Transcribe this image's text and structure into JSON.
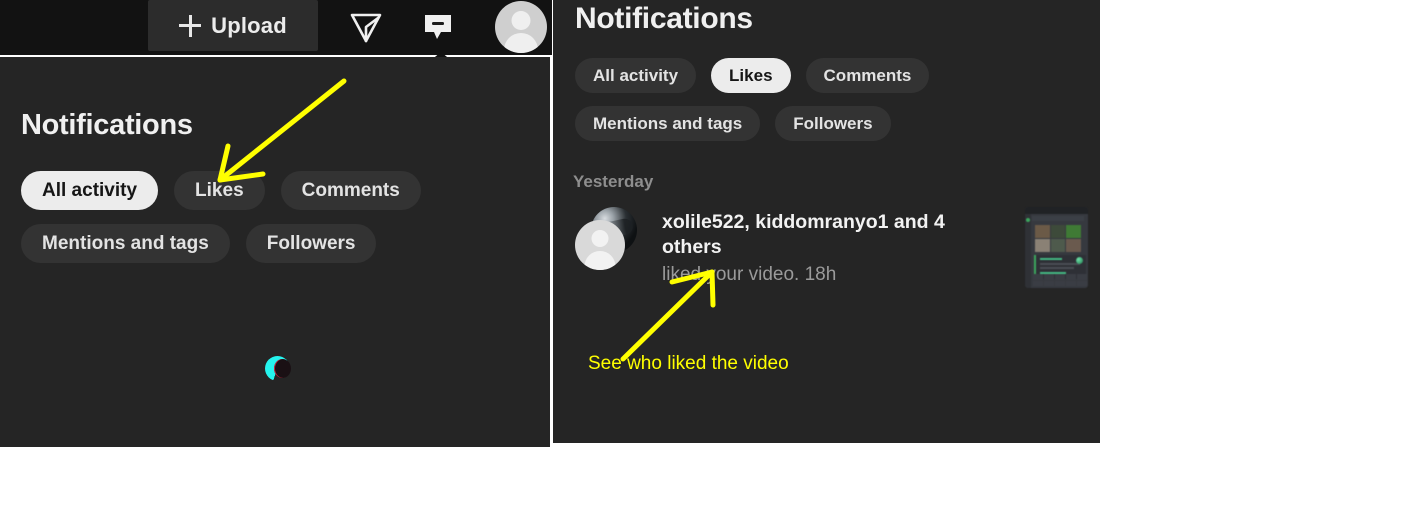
{
  "navbar": {
    "upload_button": {
      "label": "Upload",
      "icon": "plus-icon"
    },
    "send_icon": "paper-plane-icon",
    "inbox_icon": "message-bubble-icon",
    "profile_icon": "user-avatar-icon",
    "background_color": "#121212"
  },
  "panel_left": {
    "title": "Notifications",
    "filters": [
      {
        "label": "All activity",
        "selected": true
      },
      {
        "label": "Likes",
        "selected": false
      },
      {
        "label": "Comments",
        "selected": false
      },
      {
        "label": "Mentions and tags",
        "selected": false
      },
      {
        "label": "Followers",
        "selected": false
      }
    ],
    "loading": true,
    "spinner_color": "#25f4ee",
    "background_color": "#252525"
  },
  "panel_right": {
    "title": "Notifications",
    "filters": [
      {
        "label": "All activity",
        "selected": false
      },
      {
        "label": "Likes",
        "selected": true
      },
      {
        "label": "Comments",
        "selected": false
      },
      {
        "label": "Mentions and tags",
        "selected": false
      },
      {
        "label": "Followers",
        "selected": false
      }
    ],
    "section_label": "Yesterday",
    "notification": {
      "users": "xolile522, kiddomranyo1 and 4 others",
      "action": "liked your video. 18h",
      "avatar": "stacked-user-avatars",
      "thumbnail": "video-thumbnail"
    },
    "background_color": "#252525"
  },
  "annotations": {
    "color": "#ffff00",
    "arrow_to_likes_chip": "arrow-pointing-to-likes-filter",
    "arrow_to_liked_text": "arrow-pointing-to-liked-your-video",
    "caption": "See who liked the video"
  }
}
